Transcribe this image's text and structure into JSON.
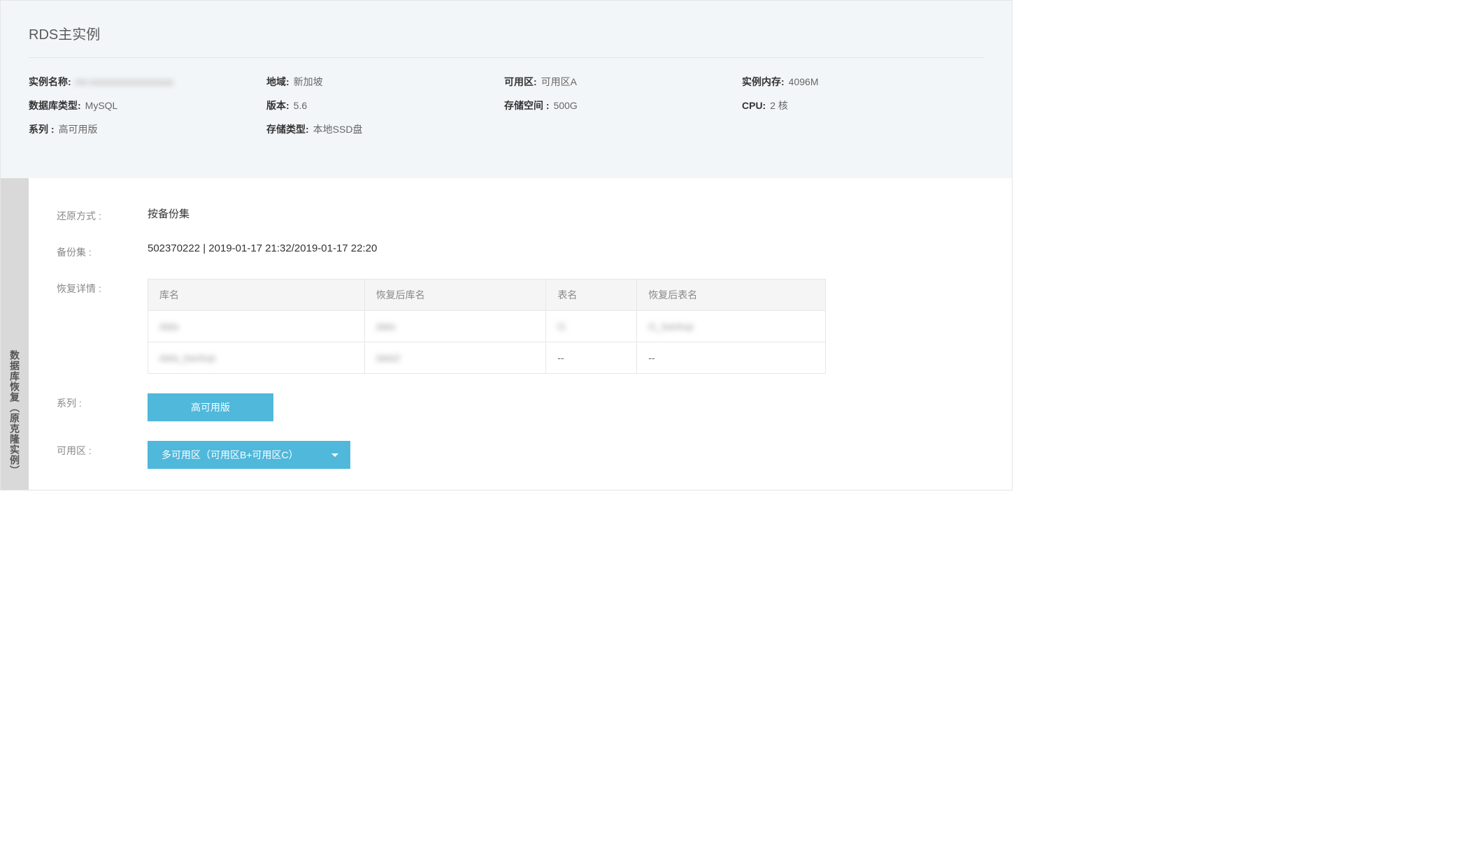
{
  "header": {
    "title": "RDS主实例",
    "info": [
      {
        "label": "实例名称:",
        "value": "rm-xxxxxxxxxxxxxxxxx",
        "blur": true
      },
      {
        "label": "地域:",
        "value": "新加坡"
      },
      {
        "label": "可用区:",
        "value": "可用区A"
      },
      {
        "label": "实例内存:",
        "value": "4096M"
      },
      {
        "label": "数据库类型:",
        "value": "MySQL"
      },
      {
        "label": "版本:",
        "value": "5.6"
      },
      {
        "label": "存储空间 :",
        "value": "500G"
      },
      {
        "label": "CPU:",
        "value": "2 核"
      },
      {
        "label": "系列 :",
        "value": "高可用版"
      },
      {
        "label": "存储类型:",
        "value": "本地SSD盘"
      }
    ]
  },
  "sideTab": "数据库恢复（原克隆实例）",
  "form": {
    "restoreMode": {
      "label": "还原方式 :",
      "value": "按备份集"
    },
    "backupSet": {
      "label": "备份集 :",
      "value": "502370222 | 2019-01-17 21:32/2019-01-17 22:20"
    },
    "restoreDetail": {
      "label": "恢复详情 :",
      "columns": [
        "库名",
        "恢复后库名",
        "表名",
        "恢复后表名"
      ],
      "rows": [
        {
          "db": "data",
          "newdb": "data",
          "tbl": "t1",
          "newtbl": "t1_backup",
          "blur": true
        },
        {
          "db": "data_backup",
          "newdb": "data2",
          "tbl": "--",
          "newtbl": "--",
          "blurPartial": true
        }
      ]
    },
    "series": {
      "label": "系列 :",
      "value": "高可用版"
    },
    "zone": {
      "label": "可用区 :",
      "value": "多可用区（可用区B+可用区C）"
    }
  }
}
